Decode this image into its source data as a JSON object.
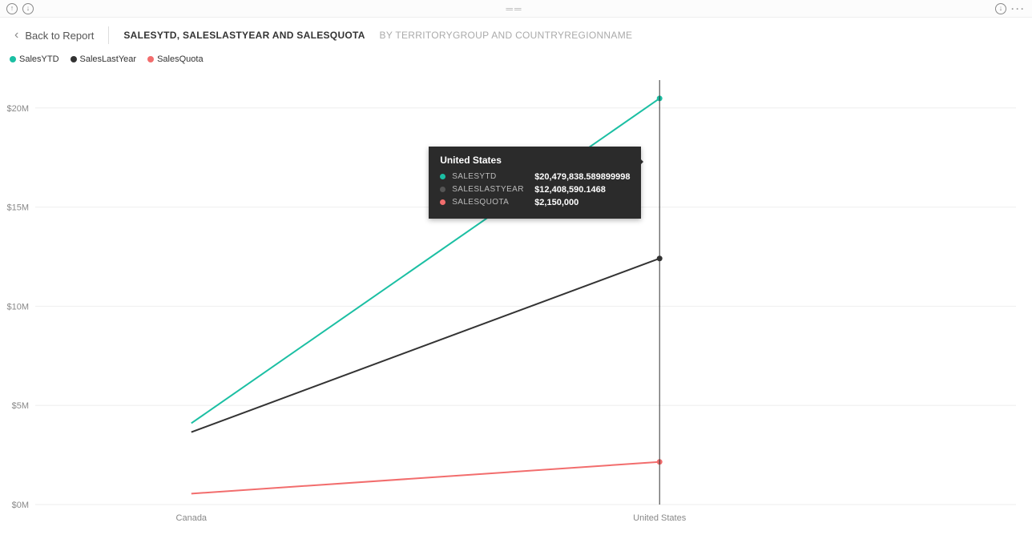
{
  "toolbar": {
    "grip": "══"
  },
  "header": {
    "back_label": "Back to Report",
    "title_main": "SALESYTD, SALESLASTYEAR AND SALESQUOTA",
    "title_sub": "BY TERRITORYGROUP AND COUNTRYREGIONNAME"
  },
  "legend": {
    "items": [
      {
        "label": "SalesYTD",
        "color": "#1bbfa3"
      },
      {
        "label": "SalesLastYear",
        "color": "#333333"
      },
      {
        "label": "SalesQuota",
        "color": "#f26d6d"
      }
    ]
  },
  "tooltip": {
    "title": "United States",
    "rows": [
      {
        "label": "SALESYTD",
        "value": "$20,479,838.589899998",
        "color": "#1bbfa3"
      },
      {
        "label": "SALESLASTYEAR",
        "value": "$12,408,590.1468",
        "color": "#555555"
      },
      {
        "label": "SALESQUOTA",
        "value": "$2,150,000",
        "color": "#f26d6d"
      }
    ]
  },
  "chart_data": {
    "type": "line",
    "categories": [
      "Canada",
      "United States"
    ],
    "series": [
      {
        "name": "SalesYTD",
        "color": "#1bbfa3",
        "values": [
          4100000,
          20479838.5899
        ]
      },
      {
        "name": "SalesLastYear",
        "color": "#333333",
        "values": [
          3650000,
          12408590.1468
        ]
      },
      {
        "name": "SalesQuota",
        "color": "#f26d6d",
        "values": [
          550000,
          2150000
        ]
      }
    ],
    "ylim": [
      0,
      21000000
    ],
    "yticks": [
      0,
      5000000,
      10000000,
      15000000,
      20000000
    ],
    "ytick_labels": [
      "$0M",
      "$5M",
      "$10M",
      "$15M",
      "$20M"
    ],
    "xlabel": "",
    "ylabel": "",
    "title": ""
  }
}
